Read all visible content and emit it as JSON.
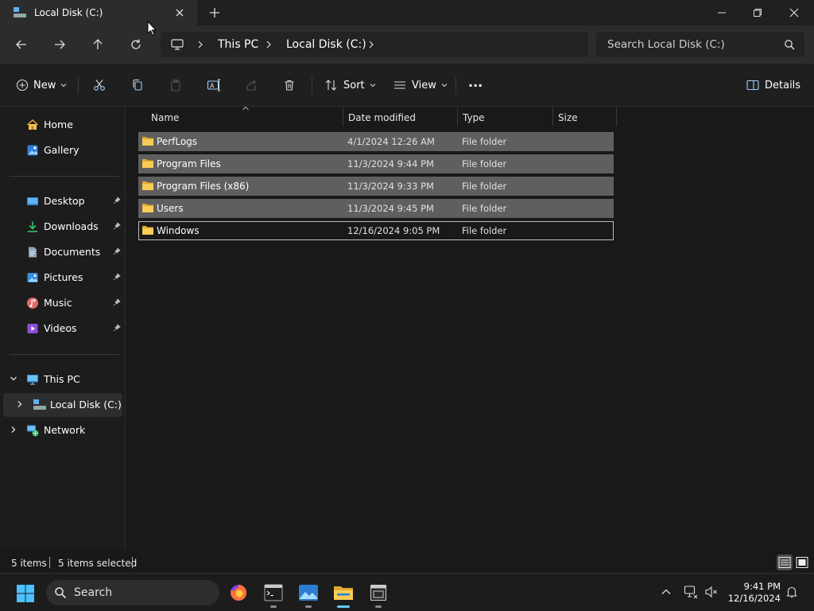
{
  "window": {
    "tab_title": "Local Disk (C:)",
    "new_tab_label": "+"
  },
  "nav": {
    "breadcrumb": [
      "This PC",
      "Local Disk (C:)"
    ],
    "search_placeholder": "Search Local Disk (C:)"
  },
  "commands": {
    "new_label": "New",
    "sort_label": "Sort",
    "view_label": "View",
    "more_label": "···",
    "details_label": "Details"
  },
  "sidebar": {
    "quick": [
      {
        "label": "Home",
        "icon": "home-icon"
      },
      {
        "label": "Gallery",
        "icon": "gallery-icon"
      }
    ],
    "pinned": [
      {
        "label": "Desktop",
        "icon": "desktop-icon"
      },
      {
        "label": "Downloads",
        "icon": "downloads-icon"
      },
      {
        "label": "Documents",
        "icon": "documents-icon"
      },
      {
        "label": "Pictures",
        "icon": "pictures-icon"
      },
      {
        "label": "Music",
        "icon": "music-icon"
      },
      {
        "label": "Videos",
        "icon": "videos-icon"
      }
    ],
    "tree": [
      {
        "label": "This PC",
        "icon": "this-pc-icon"
      },
      {
        "label": "Local Disk (C:)",
        "icon": "drive-icon"
      },
      {
        "label": "Network",
        "icon": "network-icon"
      }
    ]
  },
  "list": {
    "columns": [
      "Name",
      "Date modified",
      "Type",
      "Size"
    ],
    "rows": [
      {
        "name": "PerfLogs",
        "date": "4/1/2024 12:26 AM",
        "type": "File folder",
        "size": ""
      },
      {
        "name": "Program Files",
        "date": "11/3/2024 9:44 PM",
        "type": "File folder",
        "size": ""
      },
      {
        "name": "Program Files (x86)",
        "date": "11/3/2024 9:33 PM",
        "type": "File folder",
        "size": ""
      },
      {
        "name": "Users",
        "date": "11/3/2024 9:45 PM",
        "type": "File folder",
        "size": ""
      },
      {
        "name": "Windows",
        "date": "12/16/2024 9:05 PM",
        "type": "File folder",
        "size": ""
      }
    ]
  },
  "status": {
    "item_count": "5 items",
    "selected_count": "5 items selected"
  },
  "taskbar": {
    "search_label": "Search",
    "time": "9:41 PM",
    "date": "12/16/2024"
  },
  "colors": {
    "selection": "#5f5f5f",
    "accent": "#60cdff",
    "folder": "#f4c54a"
  }
}
